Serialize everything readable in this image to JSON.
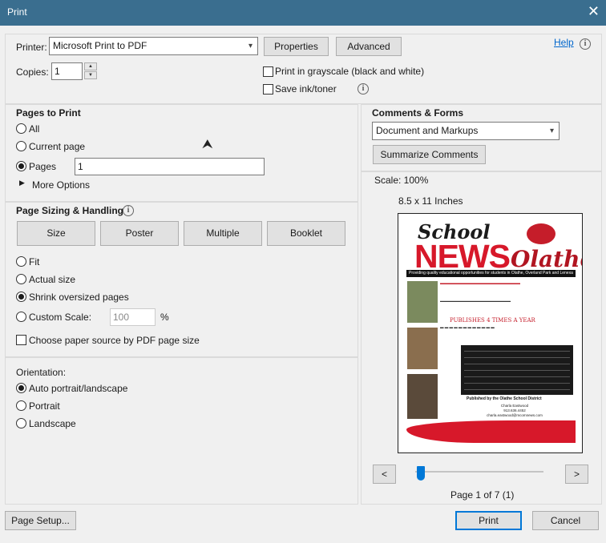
{
  "window": {
    "title": "Print",
    "close_glyph": "✕"
  },
  "printer": {
    "label": "Printer:",
    "selected": "Microsoft Print to PDF",
    "properties_label": "Properties",
    "advanced_label": "Advanced",
    "help_label": "Help",
    "copies_label": "Copies:",
    "copies_value": "1",
    "grayscale_label": "Print in grayscale (black and white)",
    "save_ink_label": "Save ink/toner"
  },
  "pages_to_print": {
    "heading": "Pages to Print",
    "all_label": "All",
    "current_label": "Current page",
    "pages_label": "Pages",
    "pages_value": "1",
    "more_options_label": "More Options",
    "selected": "pages"
  },
  "sizing": {
    "heading": "Page Sizing & Handling",
    "tabs": [
      "Size",
      "Poster",
      "Multiple",
      "Booklet"
    ],
    "fit_label": "Fit",
    "actual_label": "Actual size",
    "shrink_label": "Shrink oversized pages",
    "custom_label": "Custom Scale:",
    "custom_value": "100",
    "percent": "%",
    "paper_source_label": "Choose paper source by PDF page size",
    "selected": "shrink"
  },
  "orientation": {
    "heading": "Orientation:",
    "auto_label": "Auto portrait/landscape",
    "portrait_label": "Portrait",
    "landscape_label": "Landscape",
    "selected": "auto"
  },
  "comments": {
    "heading": "Comments & Forms",
    "selected": "Document and Markups",
    "summarize_label": "Summarize Comments"
  },
  "preview": {
    "scale": "Scale: 100%",
    "paper": "8.5 x 11 Inches",
    "page_indicator": "Page 1 of 7 (1)",
    "prev_glyph": "<",
    "next_glyph": ">",
    "slider_position": 0,
    "doc": {
      "school": "School",
      "news": "NEWS",
      "olathe": "Olathe",
      "band": "Providing quality educational opportunities for students in Olathe, Overland Park and Lenexa",
      "publishes": "PUBLISHES 4 TIMES A YEAR",
      "published_by": "Published by the Olathe School District",
      "contact_name": "Charla Eastwood",
      "contact_phone": "913.636.4452",
      "contact_email": "charla.eastwood@mcomnews.com"
    }
  },
  "footer": {
    "page_setup_label": "Page Setup...",
    "print_label": "Print",
    "cancel_label": "Cancel"
  }
}
